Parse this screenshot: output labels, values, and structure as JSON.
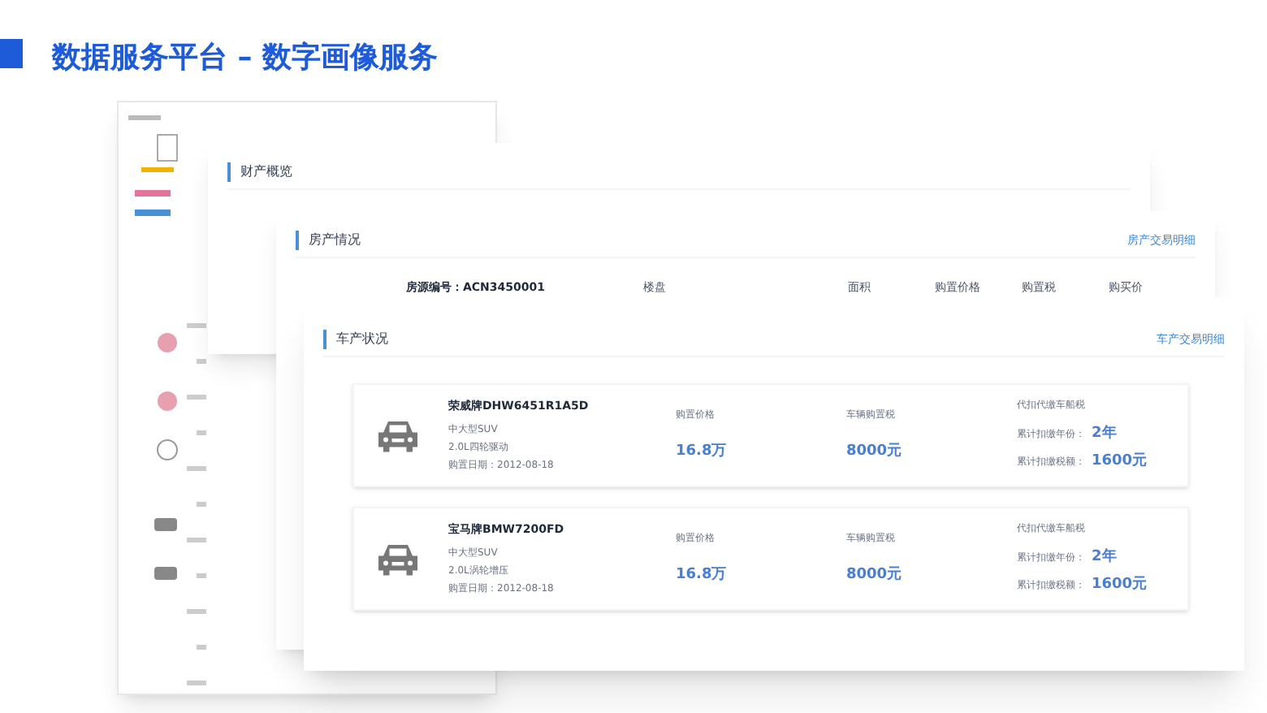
{
  "slide_title": "数据服务平台 – 数字画像服务",
  "overview_window": {
    "title": "财产概览"
  },
  "house_window": {
    "title": "房产情况",
    "link": "房产交易明细",
    "row": {
      "id": "房源编号：ACN3450001",
      "columns": [
        "楼盘",
        "面积",
        "购置价格",
        "购置税",
        "购买价"
      ]
    }
  },
  "car_window": {
    "title": "车产状况",
    "link": "车产交易明细",
    "cars": [
      {
        "model": "荣威牌DHW6451R1A5D",
        "type": "中大型SUV",
        "engine": "2.0L四轮驱动",
        "date": "购置日期：2012-08-18",
        "price_label": "购置价格",
        "price": "16.8万",
        "tax_label": "车辆购置税",
        "tax": "8000元",
        "vvt_label": "代扣代缴车船税",
        "years_label": "累计扣缴年份：",
        "years": "2年",
        "amount_label": "累计扣缴税额：",
        "amount": "1600元"
      },
      {
        "model": "宝马牌BMW7200FD",
        "type": "中大型SUV",
        "engine": "2.0L涡轮增压",
        "date": "购置日期：2012-08-18",
        "price_label": "购置价格",
        "price": "16.8万",
        "tax_label": "车辆购置税",
        "tax": "8000元",
        "vvt_label": "代扣代缴车船税",
        "years_label": "累计扣缴年份：",
        "years": "2年",
        "amount_label": "累计扣缴税额：",
        "amount": "1600元"
      }
    ]
  }
}
